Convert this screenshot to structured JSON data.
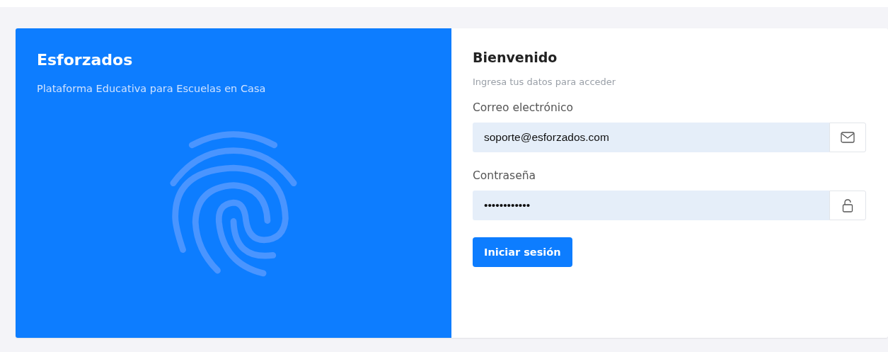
{
  "brand_panel": {
    "title": "Esforzados",
    "subtitle": "Plataforma Educativa para Escuelas en Casa"
  },
  "login_form": {
    "title": "Bienvenido",
    "subtitle": "Ingresa tus datos para acceder",
    "fields": [
      {
        "kind": "email",
        "label": "Correo electrónico",
        "value": "soporte@esforzados.com"
      },
      {
        "kind": "password",
        "label": "Contraseña",
        "value": "••••••••••••"
      }
    ],
    "submit_button": "Iniciar sesión"
  }
}
